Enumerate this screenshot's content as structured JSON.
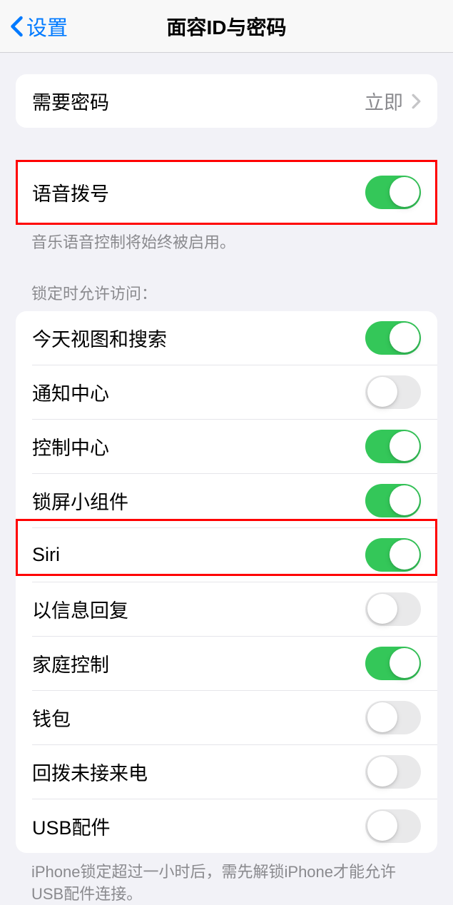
{
  "header": {
    "back_label": "设置",
    "title": "面容ID与密码"
  },
  "require_passcode": {
    "label": "需要密码",
    "value": "立即"
  },
  "voice_dial": {
    "label": "语音拨号",
    "on": true,
    "footnote": "音乐语音控制将始终被启用。"
  },
  "lock_access": {
    "header": "锁定时允许访问：",
    "items": [
      {
        "label": "今天视图和搜索",
        "on": true
      },
      {
        "label": "通知中心",
        "on": false
      },
      {
        "label": "控制中心",
        "on": true
      },
      {
        "label": "锁屏小组件",
        "on": true
      },
      {
        "label": "Siri",
        "on": true
      },
      {
        "label": "以信息回复",
        "on": false
      },
      {
        "label": "家庭控制",
        "on": true
      },
      {
        "label": "钱包",
        "on": false
      },
      {
        "label": "回拨未接来电",
        "on": false
      },
      {
        "label": "USB配件",
        "on": false
      }
    ],
    "footnote": "iPhone锁定超过一小时后，需先解锁iPhone才能允许USB配件连接。"
  }
}
